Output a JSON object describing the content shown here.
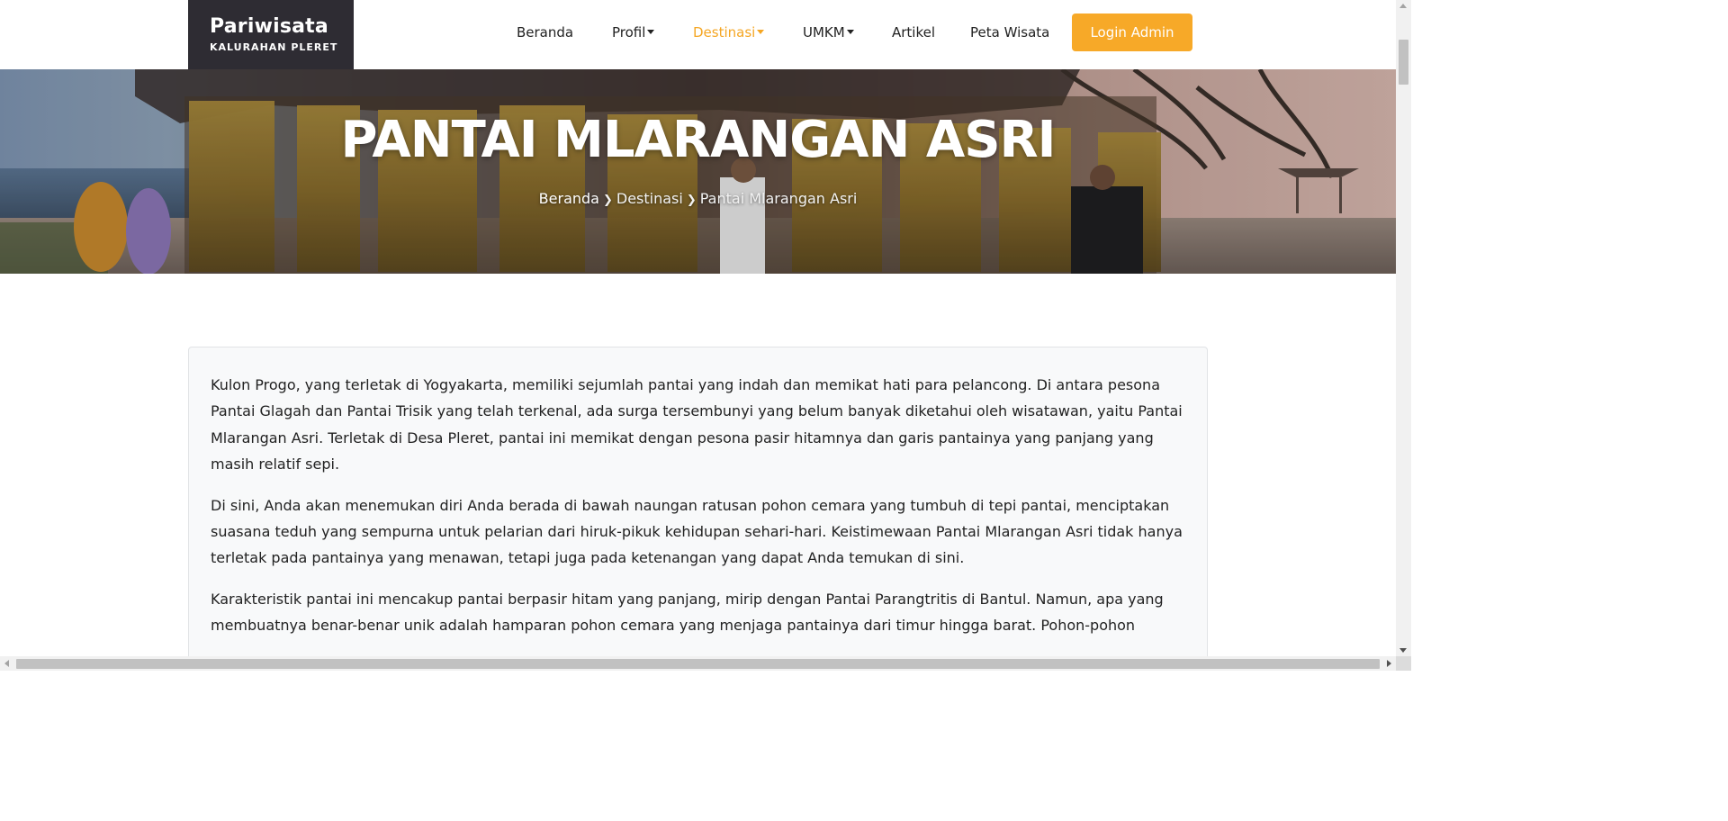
{
  "brand": {
    "title": "Pariwisata",
    "subtitle": "KALURAHAN PLERET"
  },
  "nav": {
    "items": [
      {
        "label": "Beranda"
      },
      {
        "label": "Profil"
      },
      {
        "label": "Destinasi"
      },
      {
        "label": "UMKM"
      },
      {
        "label": "Artikel"
      },
      {
        "label": "Peta Wisata"
      }
    ],
    "login_label": "Login Admin"
  },
  "hero": {
    "title": "PANTAI MLARANGAN ASRI",
    "breadcrumb": {
      "home": "Beranda",
      "section": "Destinasi",
      "current": "Pantai Mlarangan Asri"
    }
  },
  "content": {
    "paragraphs": [
      "Kulon Progo, yang terletak di Yogyakarta, memiliki sejumlah pantai yang indah dan memikat hati para pelancong. Di antara pesona Pantai Glagah dan Pantai Trisik yang telah terkenal, ada surga tersembunyi yang belum banyak diketahui oleh wisatawan, yaitu Pantai Mlarangan Asri. Terletak di Desa Pleret, pantai ini memikat dengan pesona pasir hitamnya dan garis pantainya yang panjang yang masih relatif sepi.",
      "Di sini, Anda akan menemukan diri Anda berada di bawah naungan ratusan pohon cemara yang tumbuh di tepi pantai, menciptakan suasana teduh yang sempurna untuk pelarian dari hiruk-pikuk kehidupan sehari-hari. Keistimewaan Pantai Mlarangan Asri tidak hanya terletak pada pantainya yang menawan, tetapi juga pada ketenangan yang dapat Anda temukan di sini.",
      "Karakteristik pantai ini mencakup pantai berpasir hitam yang panjang, mirip dengan Pantai Parangtritis di Bantul. Namun, apa yang membuatnya benar-benar unik adalah hamparan pohon cemara yang menjaga pantainya dari timur hingga barat. Pohon-pohon"
    ]
  },
  "colors": {
    "accent": "#f7a928",
    "brand_bg": "#2e2c33",
    "card_bg": "#f8f9fa"
  }
}
